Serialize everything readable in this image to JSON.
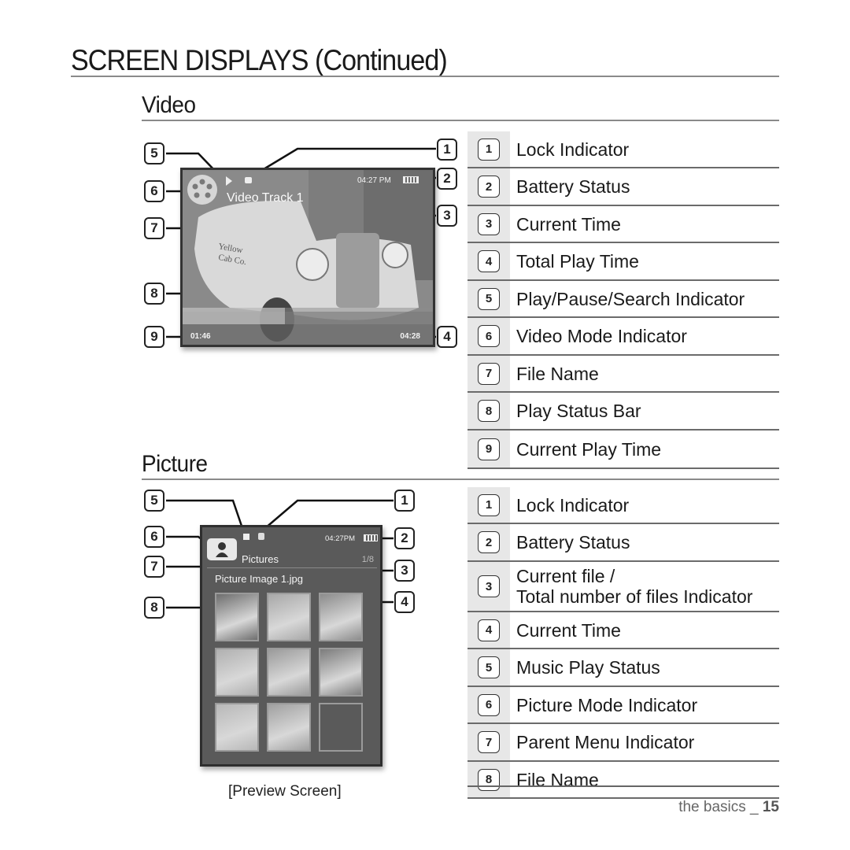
{
  "page": {
    "title": "SCREEN DISPLAYS (Continued)",
    "footer_section": "the basics",
    "footer_sep": " _ ",
    "footer_page": "15"
  },
  "video": {
    "heading": "Video",
    "screen": {
      "file_name": "Video Track 1",
      "clock": "04:27 PM",
      "current_play_time": "01:46",
      "total_play_time": "04:28",
      "play_progress": 0.41,
      "mode_icon": "film-reel-icon",
      "play_icon": "play-icon",
      "lock_icon": "lock-icon",
      "battery_icon": "battery-icon"
    },
    "legend": [
      {
        "num": "1",
        "label": "Lock Indicator"
      },
      {
        "num": "2",
        "label": "Battery Status"
      },
      {
        "num": "3",
        "label": "Current Time"
      },
      {
        "num": "4",
        "label": "Total Play Time"
      },
      {
        "num": "5",
        "label": "Play/Pause/Search Indicator"
      },
      {
        "num": "6",
        "label": "Video Mode Indicator"
      },
      {
        "num": "7",
        "label": "File Name"
      },
      {
        "num": "8",
        "label": "Play Status Bar"
      },
      {
        "num": "9",
        "label": "Current Play Time"
      }
    ]
  },
  "picture": {
    "heading": "Picture",
    "caption": "[Preview Screen]",
    "screen": {
      "parent_menu": "Pictures",
      "file_counter": "1/8",
      "file_name": "Picture Image 1.jpg",
      "clock": "04:27PM",
      "mode_icon": "person-icon",
      "music_status_icon": "stop-icon",
      "lock_icon": "lock-icon",
      "battery_icon": "battery-icon",
      "thumbnails": [
        "cat",
        "eiffel-tower",
        "dog",
        "pagoda",
        "taxi",
        "storefront",
        "seal",
        "flower",
        ""
      ]
    },
    "legend": [
      {
        "num": "1",
        "label": "Lock Indicator"
      },
      {
        "num": "2",
        "label": "Battery Status"
      },
      {
        "num": "3",
        "label": "Current file /",
        "label2": "Total number of files Indicator"
      },
      {
        "num": "4",
        "label": "Current Time"
      },
      {
        "num": "5",
        "label": "Music Play Status"
      },
      {
        "num": "6",
        "label": "Picture Mode Indicator"
      },
      {
        "num": "7",
        "label": "Parent Menu Indicator"
      },
      {
        "num": "8",
        "label": "File Name"
      }
    ]
  }
}
